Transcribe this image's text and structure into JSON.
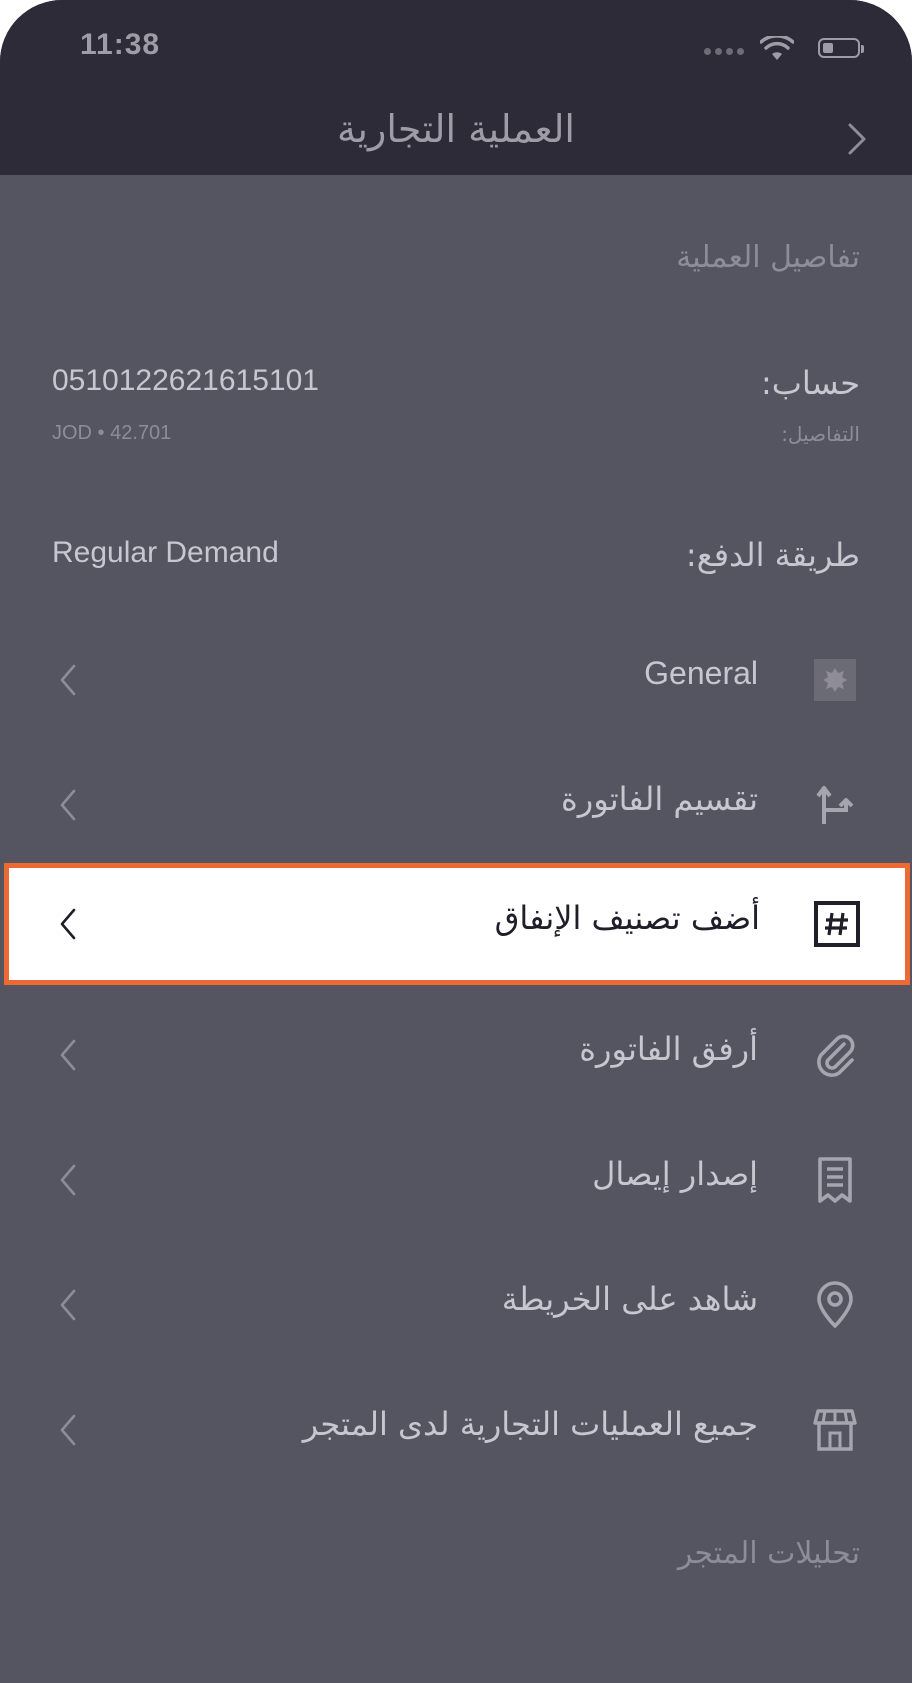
{
  "status_bar": {
    "time": "11:38"
  },
  "nav": {
    "title": "العملية التجارية",
    "back_icon": "chevron-right-icon"
  },
  "details": {
    "section_title": "تفاصيل العملية",
    "account_label": "حساب:",
    "account_number": "0510122621615101",
    "details_label": "التفاصيل:",
    "amount_line": "JOD  •  42.701",
    "payment_label": "طريقة الدفع:",
    "payment_value": "Regular Demand"
  },
  "rows": [
    {
      "label": "General",
      "icon": "category-icon"
    },
    {
      "label": "تقسيم الفاتورة",
      "icon": "split-icon"
    },
    {
      "label": "أضف تصنيف الإنفاق",
      "icon": "hashtag-icon"
    },
    {
      "label": "أرفق الفاتورة",
      "icon": "paperclip-icon"
    },
    {
      "label": "إصدار إيصال",
      "icon": "receipt-icon"
    },
    {
      "label": "شاهد على الخريطة",
      "icon": "location-pin-icon"
    },
    {
      "label": "جميع العمليات التجارية لدى المتجر",
      "icon": "store-icon"
    }
  ],
  "analytics": {
    "section_title": "تحليلات المتجر"
  },
  "colors": {
    "highlight_border": "#ee6a35",
    "background": "#555461",
    "header": "#2c2b37"
  }
}
